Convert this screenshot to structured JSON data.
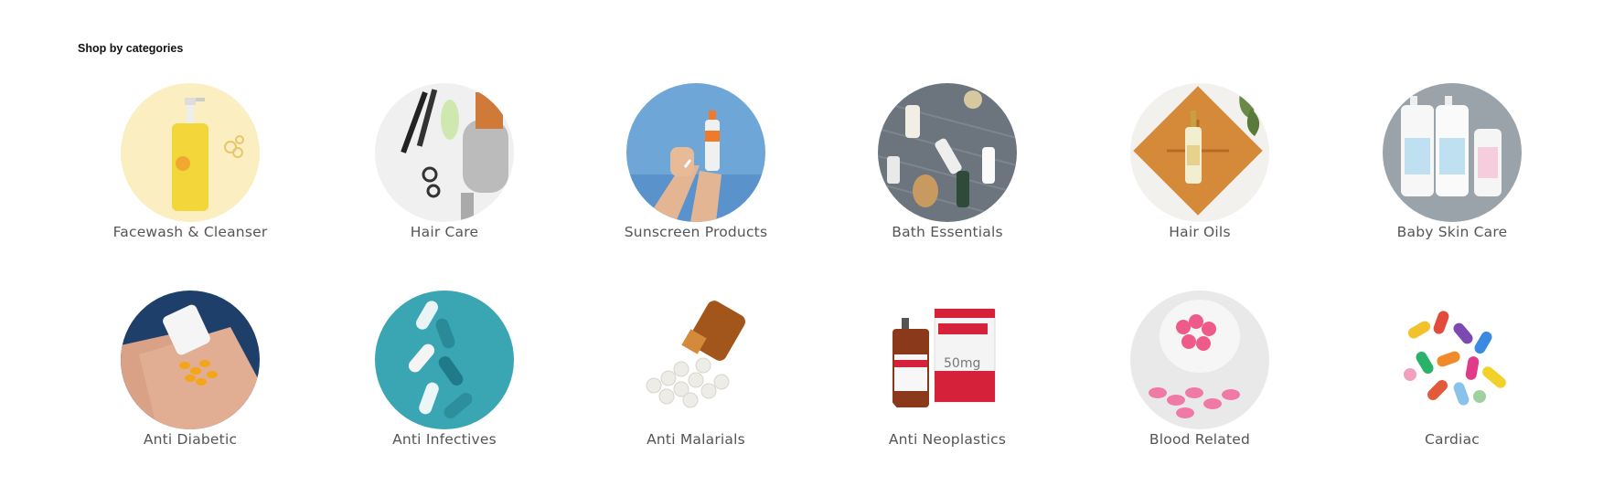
{
  "section": {
    "title": "Shop by categories"
  },
  "categories": [
    {
      "label": "Facewash & Cleanser",
      "icon": "facewash-bottle-image"
    },
    {
      "label": "Hair Care",
      "icon": "hair-tools-image"
    },
    {
      "label": "Sunscreen Products",
      "icon": "sunscreen-hand-image"
    },
    {
      "label": "Bath Essentials",
      "icon": "bath-products-image"
    },
    {
      "label": "Hair Oils",
      "icon": "hair-oil-bottle-image"
    },
    {
      "label": "Baby Skin Care",
      "icon": "baby-lotion-image"
    },
    {
      "label": "Anti Diabetic",
      "icon": "pills-in-hand-image"
    },
    {
      "label": "Anti Infectives",
      "icon": "capsules-image"
    },
    {
      "label": "Anti Malarials",
      "icon": "spilled-tablets-image"
    },
    {
      "label": "Anti Neoplastics",
      "icon": "medicine-box-vial-image"
    },
    {
      "label": "Blood Related",
      "icon": "pink-tablets-image"
    },
    {
      "label": "Cardiac",
      "icon": "colorful-pills-image"
    }
  ],
  "colors": {
    "label": "#555555",
    "title": "#111111",
    "background": "#ffffff"
  }
}
